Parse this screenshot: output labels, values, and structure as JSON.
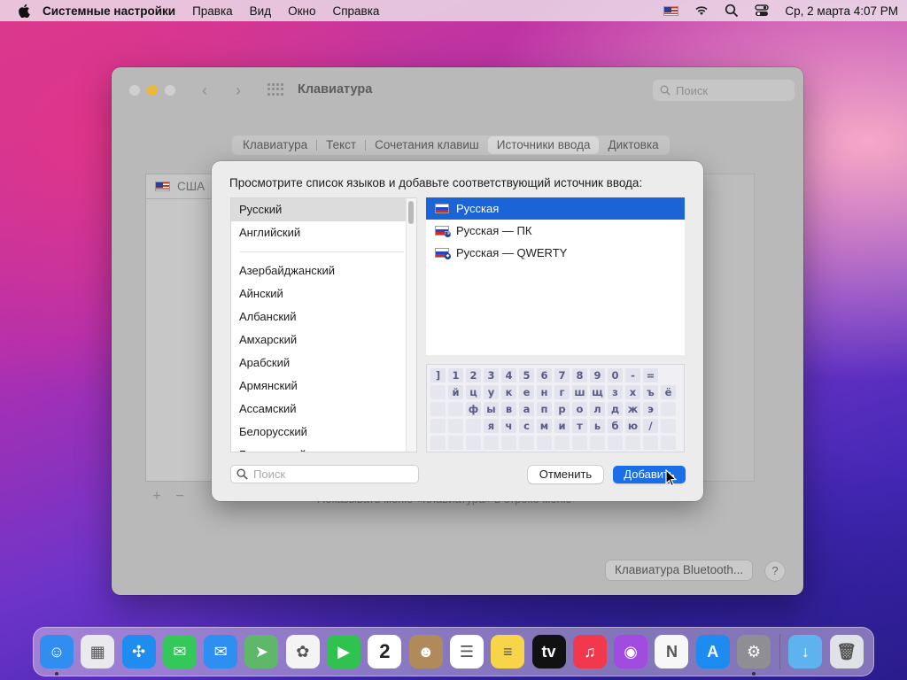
{
  "menubar": {
    "app_name": "Системные настройки",
    "items": [
      "Правка",
      "Вид",
      "Окно",
      "Справка"
    ],
    "clock": "Ср, 2 марта  4:07 PM"
  },
  "window": {
    "title": "Клавиатура",
    "search_placeholder": "Поиск",
    "tabs": [
      "Клавиатура",
      "Текст",
      "Сочетания клавиш",
      "Источники ввода",
      "Диктовка"
    ],
    "active_tab": "Источники ввода",
    "current_source": "США",
    "show_menu_label": "Показывать меню «Клавиатура» в строке меню",
    "bluetooth_button": "Клавиатура Bluetooth...",
    "help_button": "?"
  },
  "sheet": {
    "title": "Просмотрите список языков и добавьте соответствующий источник ввода:",
    "languages_top": [
      "Русский",
      "Английский"
    ],
    "languages": [
      "Азербайджанский",
      "Айнский",
      "Албанский",
      "Амхарский",
      "Арабский",
      "Армянский",
      "Ассамский",
      "Белорусский",
      "Бенгальский"
    ],
    "sources": [
      {
        "label": "Русская",
        "selected": true
      },
      {
        "label": "Русская — ПК",
        "selected": false
      },
      {
        "label": "Русская — QWERTY",
        "selected": false
      }
    ],
    "keyboard_rows": [
      [
        "]",
        "1",
        "2",
        "3",
        "4",
        "5",
        "6",
        "7",
        "8",
        "9",
        "0",
        "-",
        "="
      ],
      [
        "",
        "й",
        "ц",
        "у",
        "к",
        "е",
        "н",
        "г",
        "ш",
        "щ",
        "з",
        "х",
        "ъ",
        "ё"
      ],
      [
        "",
        "",
        "ф",
        "ы",
        "в",
        "а",
        "п",
        "р",
        "о",
        "л",
        "д",
        "ж",
        "э",
        ""
      ],
      [
        "",
        "",
        "",
        "я",
        "ч",
        "с",
        "м",
        "и",
        "т",
        "ь",
        "б",
        "ю",
        "/",
        ""
      ],
      [
        "",
        "",
        "",
        "",
        "",
        "",
        "",
        "",
        "",
        "",
        "",
        "",
        "",
        ""
      ]
    ],
    "search_placeholder": "Поиск",
    "cancel_button": "Отменить",
    "add_button": "Добавить"
  },
  "dock": {
    "apps": [
      {
        "name": "finder",
        "color": "#2f8ef0",
        "glyph": "☺",
        "running": true
      },
      {
        "name": "launchpad",
        "color": "#e9e9ee",
        "glyph": "▦",
        "running": false
      },
      {
        "name": "safari",
        "color": "#1f8cf0",
        "glyph": "✣",
        "running": false
      },
      {
        "name": "messages",
        "color": "#34c759",
        "glyph": "✉",
        "running": false
      },
      {
        "name": "mail",
        "color": "#2d8ff2",
        "glyph": "✉",
        "running": false
      },
      {
        "name": "maps",
        "color": "#5fb86a",
        "glyph": "➤",
        "running": false
      },
      {
        "name": "photos",
        "color": "#f4f4f4",
        "glyph": "✿",
        "running": false
      },
      {
        "name": "facetime",
        "color": "#30c24f",
        "glyph": "▶",
        "running": false
      },
      {
        "name": "calendar",
        "color": "#ffffff",
        "glyph": "2",
        "running": false
      },
      {
        "name": "contacts",
        "color": "#b08a5a",
        "glyph": "☻",
        "running": false
      },
      {
        "name": "reminders",
        "color": "#ffffff",
        "glyph": "☰",
        "running": false
      },
      {
        "name": "notes",
        "color": "#f8d548",
        "glyph": "≡",
        "running": false
      },
      {
        "name": "tv",
        "color": "#111111",
        "glyph": "tv",
        "running": false
      },
      {
        "name": "music",
        "color": "#f2384c",
        "glyph": "♫",
        "running": false
      },
      {
        "name": "podcasts",
        "color": "#a24be0",
        "glyph": "◉",
        "running": false
      },
      {
        "name": "news",
        "color": "#f7f7f7",
        "glyph": "N",
        "running": false
      },
      {
        "name": "app-store",
        "color": "#1c8cf1",
        "glyph": "A",
        "running": false
      },
      {
        "name": "system-preferences",
        "color": "#8e8e93",
        "glyph": "⚙",
        "running": true
      }
    ],
    "trailing": [
      {
        "name": "downloads-folder",
        "color": "#5eb3ee",
        "glyph": "↓"
      },
      {
        "name": "trash",
        "color": "#dfe3e8",
        "glyph": "🗑"
      }
    ]
  }
}
